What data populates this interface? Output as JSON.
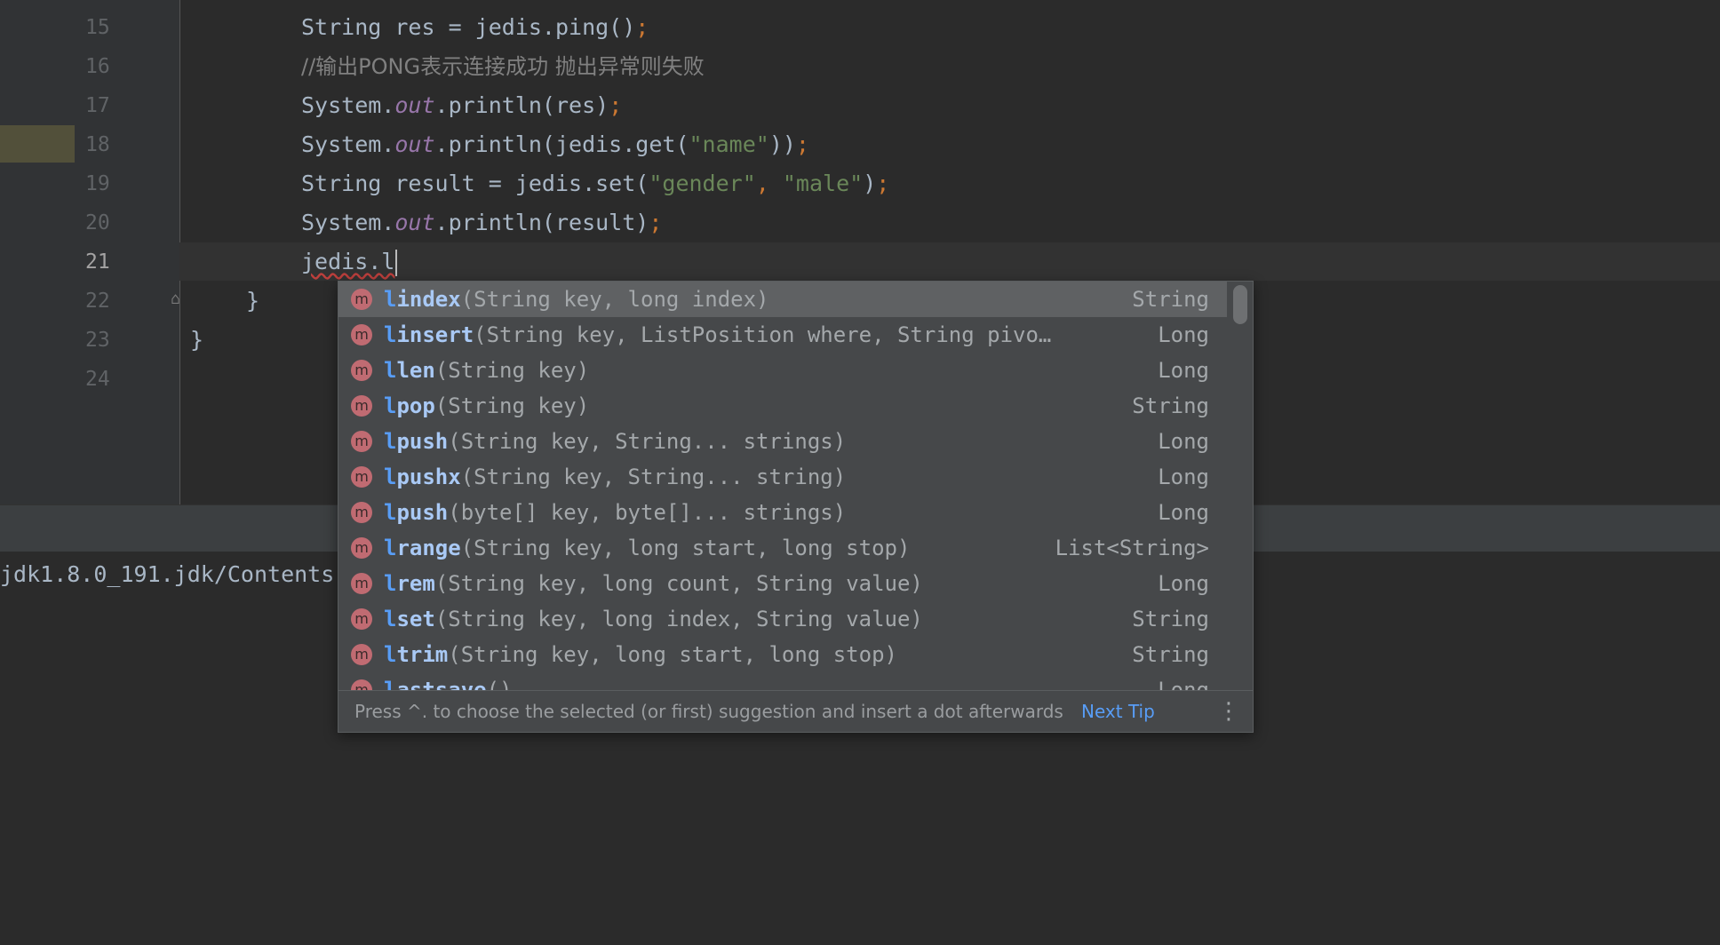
{
  "editor": {
    "lines": [
      {
        "no": "15",
        "indent": "2",
        "tokens": [
          {
            "t": "String res = jedis.ping()",
            "c": ""
          },
          {
            "t": ";",
            "c": "k-semi"
          }
        ]
      },
      {
        "no": "16",
        "indent": "2",
        "tokens": [
          {
            "t": "//输出PONG表示连接成功 抛出异常则失败",
            "c": "k-comment"
          }
        ]
      },
      {
        "no": "17",
        "indent": "2",
        "tokens": [
          {
            "t": "System.",
            "c": ""
          },
          {
            "t": "out",
            "c": "k-italic"
          },
          {
            "t": ".println(res)",
            "c": ""
          },
          {
            "t": ";",
            "c": "k-semi"
          }
        ]
      },
      {
        "no": "18",
        "indent": "2",
        "tokens": [
          {
            "t": "System.",
            "c": ""
          },
          {
            "t": "out",
            "c": "k-italic"
          },
          {
            "t": ".println(jedis.get(",
            "c": ""
          },
          {
            "t": "\"name\"",
            "c": "k-str"
          },
          {
            "t": "))",
            "c": ""
          },
          {
            "t": ";",
            "c": "k-semi"
          }
        ]
      },
      {
        "no": "19",
        "indent": "2",
        "tokens": [
          {
            "t": "String result = jedis.set(",
            "c": ""
          },
          {
            "t": "\"gender\"",
            "c": "k-str"
          },
          {
            "t": ", ",
            "c": "k-semi"
          },
          {
            "t": "\"male\"",
            "c": "k-str"
          },
          {
            "t": ")",
            "c": ""
          },
          {
            "t": ";",
            "c": "k-semi"
          }
        ]
      },
      {
        "no": "20",
        "indent": "2",
        "tokens": [
          {
            "t": "System.",
            "c": ""
          },
          {
            "t": "out",
            "c": "k-italic"
          },
          {
            "t": ".println(result)",
            "c": ""
          },
          {
            "t": ";",
            "c": "k-semi"
          }
        ]
      },
      {
        "no": "21",
        "indent": "2",
        "current": true,
        "tokens": [
          {
            "t": "jedis.l",
            "c": "k-err"
          },
          {
            "t": "",
            "c": "caret"
          }
        ]
      },
      {
        "no": "22",
        "indent": "1",
        "tokens": [
          {
            "t": "}",
            "c": ""
          }
        ]
      },
      {
        "no": "23",
        "indent": "0",
        "tokens": [
          {
            "t": "}",
            "c": ""
          }
        ]
      },
      {
        "no": "24",
        "indent": "0",
        "tokens": []
      }
    ]
  },
  "console": {
    "text": "jdk1.8.0_191.jdk/Contents"
  },
  "completion": {
    "typed_prefix": "l",
    "items": [
      {
        "prefix": "l",
        "name": "index",
        "sig": "(String key, long index)",
        "type": "String"
      },
      {
        "prefix": "l",
        "name": "insert",
        "sig": "(String key, ListPosition where, String pivo…",
        "type": "Long"
      },
      {
        "prefix": "l",
        "name": "len",
        "sig": "(String key)",
        "type": "Long"
      },
      {
        "prefix": "l",
        "name": "pop",
        "sig": "(String key)",
        "type": "String"
      },
      {
        "prefix": "l",
        "name": "push",
        "sig": "(String key, String... strings)",
        "type": "Long"
      },
      {
        "prefix": "l",
        "name": "pushx",
        "sig": "(String key, String... string)",
        "type": "Long"
      },
      {
        "prefix": "l",
        "name": "push",
        "sig": "(byte[] key, byte[]... strings)",
        "type": "Long"
      },
      {
        "prefix": "l",
        "name": "range",
        "sig": "(String key, long start, long stop)",
        "type": "List<String>"
      },
      {
        "prefix": "l",
        "name": "rem",
        "sig": "(String key, long count, String value)",
        "type": "Long"
      },
      {
        "prefix": "l",
        "name": "set",
        "sig": "(String key, long index, String value)",
        "type": "String"
      },
      {
        "prefix": "l",
        "name": "trim",
        "sig": "(String key, long start, long stop)",
        "type": "String"
      },
      {
        "prefix": "l",
        "name": "astsave",
        "sig": "()",
        "type": "Long"
      }
    ],
    "icon_letter": "m",
    "footer_tip": "Press ^. to choose the selected (or first) suggestion and insert a dot afterwards",
    "next_tip": "Next Tip",
    "more_icon": "⋮"
  },
  "colors": {
    "background": "#2b2b2b",
    "popup": "#46484a",
    "selected_row": "#5f6163",
    "match_highlight": "#589df6",
    "method_icon": "#c06b72"
  }
}
